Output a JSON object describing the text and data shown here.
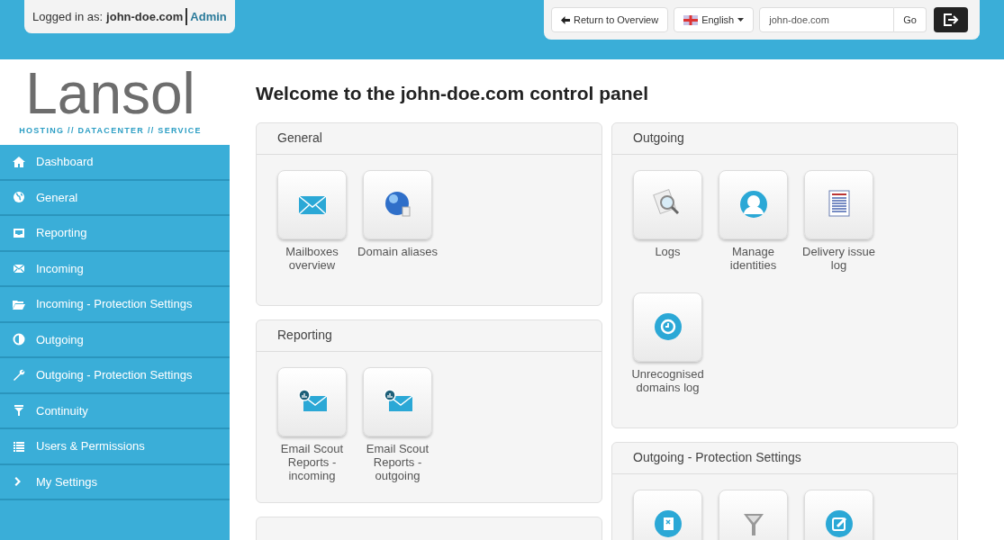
{
  "header": {
    "logged_in_label": "Logged in as:",
    "account": "john-doe.com",
    "role": "Admin",
    "return_button": "Return to Overview",
    "language": "English",
    "domain_value": "john-doe.com",
    "go_button": "Go"
  },
  "logo": {
    "name": "Lansol",
    "tagline": "HOSTING // DATACENTER // SERVICE"
  },
  "sidebar": {
    "items": [
      {
        "label": "Dashboard",
        "kind": "home"
      },
      {
        "label": "General",
        "kind": "globe"
      },
      {
        "label": "Reporting",
        "kind": "inbox"
      },
      {
        "label": "Incoming",
        "kind": "mail"
      },
      {
        "label": "Incoming - Protection Settings",
        "kind": "folder"
      },
      {
        "label": "Outgoing",
        "kind": "half"
      },
      {
        "label": "Outgoing - Protection Settings",
        "kind": "wrench"
      },
      {
        "label": "Continuity",
        "kind": "filter"
      },
      {
        "label": "Users & Permissions",
        "kind": "list"
      },
      {
        "label": "My Settings",
        "kind": "chevron"
      }
    ]
  },
  "title": "Welcome to the john-doe.com control panel",
  "columns": [
    {
      "panels": [
        {
          "title": "General",
          "tiles": [
            {
              "label": "Mailboxes overview",
              "kind": "mail"
            },
            {
              "label": "Domain aliases",
              "kind": "globe"
            }
          ]
        },
        {
          "title": "Reporting",
          "tiles": [
            {
              "label": "Email Scout Reports - incoming",
              "kind": "scout"
            },
            {
              "label": "Email Scout Reports - outgoing",
              "kind": "scout"
            }
          ]
        }
      ]
    },
    {
      "panels": [
        {
          "title": "Outgoing",
          "tiles": [
            {
              "label": "Logs",
              "kind": "search"
            },
            {
              "label": "Manage identities",
              "kind": "person"
            },
            {
              "label": "Delivery issue log",
              "kind": "document"
            },
            {
              "label": "Unrecognised domains log",
              "kind": "clock"
            }
          ]
        },
        {
          "title": "Outgoing - Protection Settings",
          "tiles": [
            {
              "kind": "blocked"
            },
            {
              "kind": "funnel"
            },
            {
              "kind": "edit"
            }
          ]
        }
      ]
    }
  ]
}
